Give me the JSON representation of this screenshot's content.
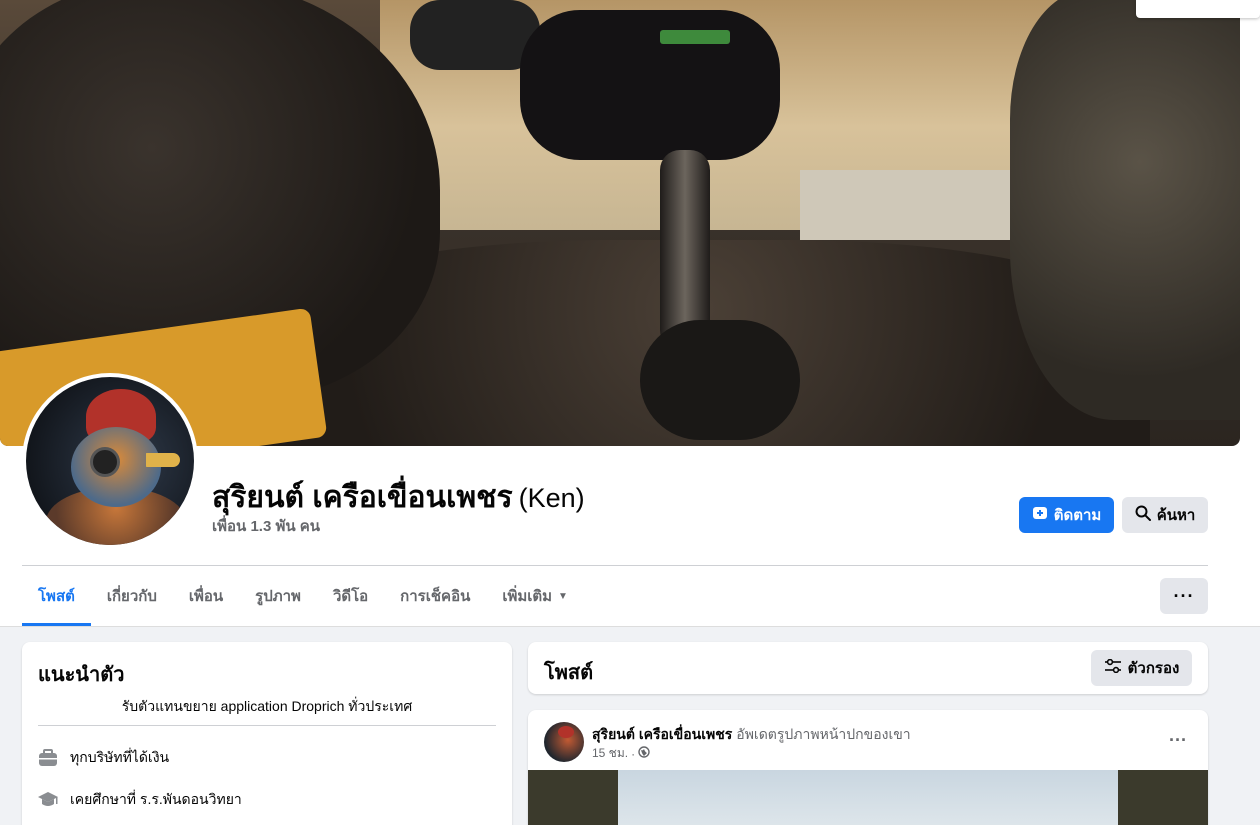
{
  "profile": {
    "name": "สุริยนต์ เครือเขื่อนเพชร",
    "alt_name": "(Ken)",
    "friends": "เพื่อน 1.3 พัน คน"
  },
  "actions": {
    "follow_label": "ติดตาม",
    "search_label": "ค้นหา",
    "more_label": "···"
  },
  "tabs": [
    {
      "label": "โพสต์",
      "active": true
    },
    {
      "label": "เกี่ยวกับ"
    },
    {
      "label": "เพื่อน"
    },
    {
      "label": "รูปภาพ"
    },
    {
      "label": "วิดีโอ"
    },
    {
      "label": "การเช็คอิน"
    },
    {
      "label": "เพิ่มเติม"
    }
  ],
  "intro": {
    "title": "แนะนำตัว",
    "bio": "รับตัวแทนขยาย application Droprich ทั่วประเทศ",
    "items": [
      {
        "icon": "briefcase-icon",
        "text": "ทุกบริษัทที่ได้เงิน"
      },
      {
        "icon": "graduation-cap-icon",
        "text": "เคยศึกษาที่ ร.ร.พันดอนวิทยา"
      }
    ]
  },
  "posts_section": {
    "title": "โพสต์",
    "filter_label": "ตัวกรอง"
  },
  "post": {
    "author": "สุริยนต์ เครือเขื่อนเพชร",
    "action": "อัพเดตรูปภาพหน้าปกของเขา",
    "time": "15 ชม.",
    "separator": "·",
    "privacy_icon": "globe-icon",
    "menu_label": "···"
  },
  "colors": {
    "accent": "#1877f2",
    "background": "#f0f2f5",
    "secondary_button": "#e4e6eb",
    "muted_text": "#65676b"
  }
}
